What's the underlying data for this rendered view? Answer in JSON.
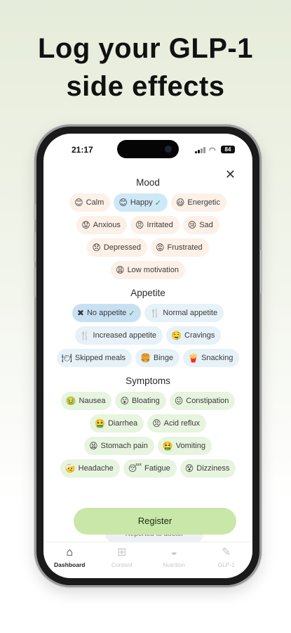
{
  "headline": {
    "line1": "Log your GLP-1",
    "line2": "side effects"
  },
  "status": {
    "time": "21:17",
    "battery": "84"
  },
  "sections": {
    "mood": {
      "title": "Mood",
      "options": [
        {
          "label": "Calm",
          "icon": "😊",
          "selected": false
        },
        {
          "label": "Happy",
          "icon": "😊",
          "selected": true
        },
        {
          "label": "Energetic",
          "icon": "😃",
          "selected": false
        },
        {
          "label": "Anxious",
          "icon": "😟",
          "selected": false
        },
        {
          "label": "Irritated",
          "icon": "😠",
          "selected": false
        },
        {
          "label": "Sad",
          "icon": "😢",
          "selected": false
        },
        {
          "label": "Depressed",
          "icon": "😞",
          "selected": false
        },
        {
          "label": "Frustrated",
          "icon": "😡",
          "selected": false
        },
        {
          "label": "Low motivation",
          "icon": "😩",
          "selected": false
        }
      ]
    },
    "appetite": {
      "title": "Appetite",
      "options": [
        {
          "label": "No appetite",
          "icon": "✖",
          "selected": true
        },
        {
          "label": "Normal appetite",
          "icon": "🍴",
          "selected": false
        },
        {
          "label": "Increased appetite",
          "icon": "🍴",
          "selected": false
        },
        {
          "label": "Cravings",
          "icon": "🤤",
          "selected": false
        },
        {
          "label": "Skipped meals",
          "icon": "🍽",
          "selected": false
        },
        {
          "label": "Binge",
          "icon": "🍔",
          "selected": false
        },
        {
          "label": "Snacking",
          "icon": "🍟",
          "selected": false
        }
      ]
    },
    "symptoms": {
      "title": "Symptoms",
      "options": [
        {
          "label": "Nausea",
          "icon": "🤢"
        },
        {
          "label": "Bloating",
          "icon": "😮"
        },
        {
          "label": "Constipation",
          "icon": "😖"
        },
        {
          "label": "Diarrhea",
          "icon": "🤮"
        },
        {
          "label": "Acid reflux",
          "icon": "😣"
        },
        {
          "label": "Stomach pain",
          "icon": "😫"
        },
        {
          "label": "Vomiting",
          "icon": "🤮"
        },
        {
          "label": "Headache",
          "icon": "🤕"
        },
        {
          "label": "Fatigue",
          "icon": "😴"
        },
        {
          "label": "Dizziness",
          "icon": "😵"
        }
      ]
    }
  },
  "register_label": "Register",
  "peek_label": "Reported to doctor",
  "nav": [
    {
      "label": "Dashboard",
      "icon": "⌂",
      "active": true
    },
    {
      "label": "Content",
      "icon": "⊞",
      "active": false
    },
    {
      "label": "Nutrition",
      "icon": "◒",
      "active": false
    },
    {
      "label": "GLP-1",
      "icon": "✎",
      "active": false
    }
  ]
}
